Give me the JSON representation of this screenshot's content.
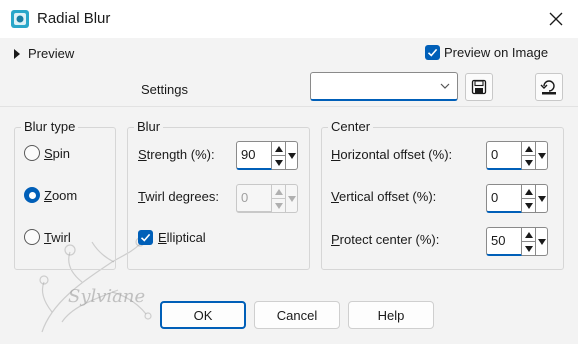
{
  "window": {
    "title": "Radial Blur",
    "app_icon": "psp-filter-icon",
    "close_icon": "close-icon"
  },
  "top": {
    "preview_label": "Preview",
    "preview_on_image_label": "Preview on Image",
    "preview_on_image_checked": true,
    "settings_label": "Settings",
    "settings_value": "",
    "save_icon": "save-icon",
    "reset_icon": "reset-icon"
  },
  "blur_type": {
    "title": "Blur type",
    "options": [
      {
        "label": "Spin",
        "mnemonic": "S",
        "rest": "pin",
        "selected": false
      },
      {
        "label": "Zoom",
        "mnemonic": "Z",
        "rest": "oom",
        "selected": true
      },
      {
        "label": "Twirl",
        "mnemonic": "T",
        "rest": "wirl",
        "selected": false
      }
    ]
  },
  "blur": {
    "title": "Blur",
    "strength_label": "Strength (%):",
    "strength_value": "90",
    "twirl_label": "Twirl degrees:",
    "twirl_value": "0",
    "twirl_enabled": false,
    "elliptical_label": "Elliptical",
    "elliptical_checked": true
  },
  "center": {
    "title": "Center",
    "horizontal_label": "Horizontal offset (%):",
    "horizontal_value": "0",
    "vertical_label": "Vertical offset (%):",
    "vertical_value": "0",
    "protect_label": "Protect center (%):",
    "protect_value": "50"
  },
  "buttons": {
    "ok": "OK",
    "cancel": "Cancel",
    "help": "Help"
  },
  "watermark": {
    "text": "Sylviane"
  },
  "colors": {
    "accent": "#005fb8",
    "panel": "#f3f3f3"
  }
}
